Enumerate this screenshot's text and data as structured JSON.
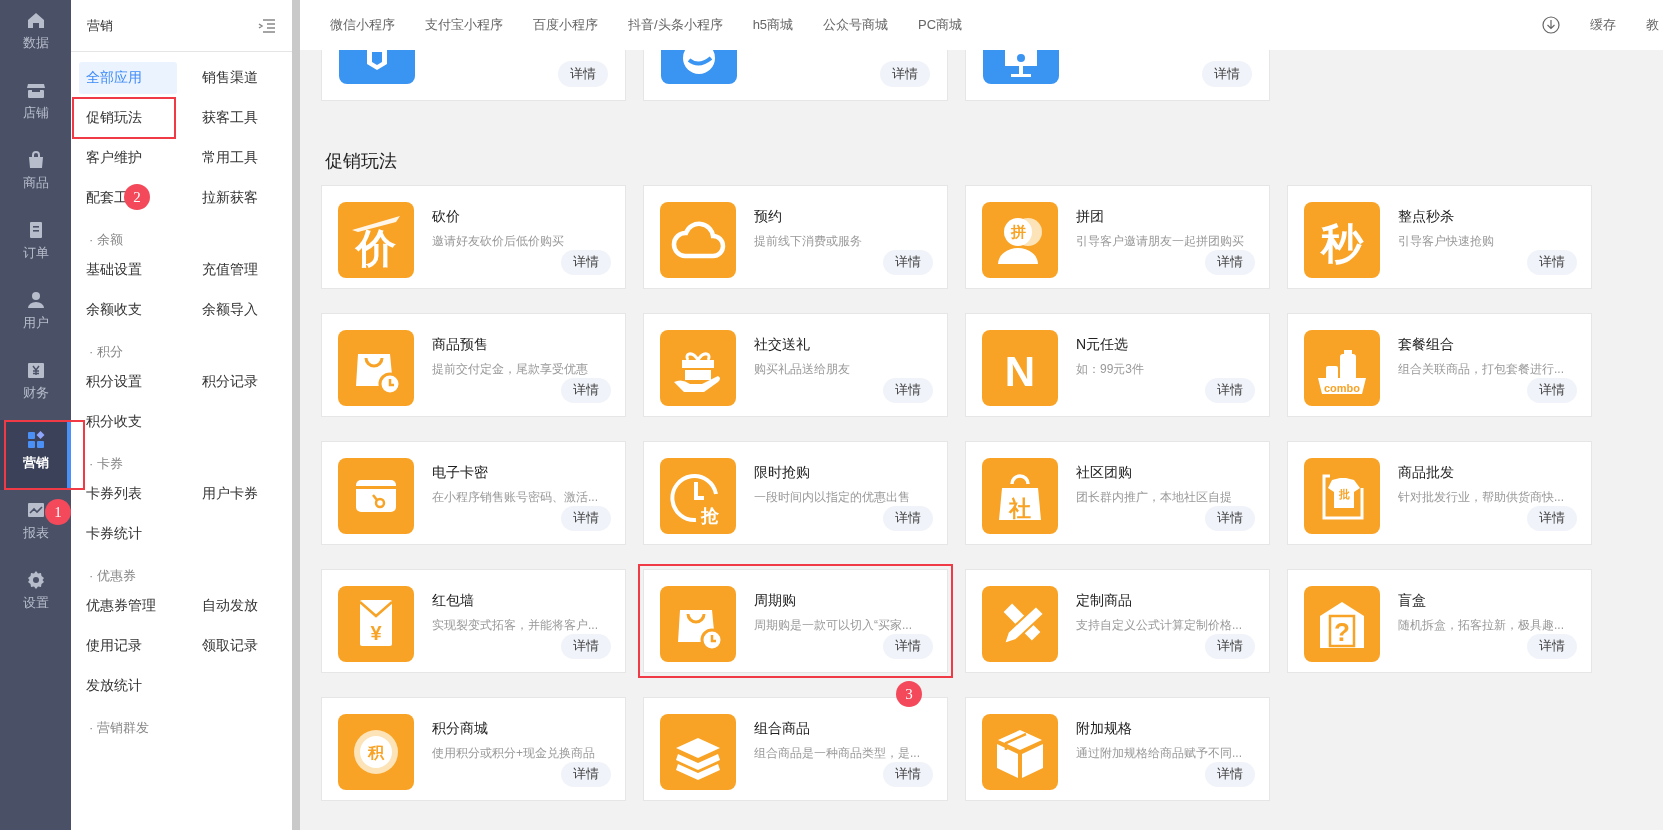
{
  "nav": {
    "items": [
      {
        "label": "数据",
        "kind": "home",
        "selected": false,
        "highlighted": false
      },
      {
        "label": "店铺",
        "kind": "store",
        "selected": false,
        "highlighted": false
      },
      {
        "label": "商品",
        "kind": "bag",
        "selected": false,
        "highlighted": false
      },
      {
        "label": "订单",
        "kind": "doc",
        "selected": false,
        "highlighted": false
      },
      {
        "label": "用户",
        "kind": "user",
        "selected": false,
        "highlighted": false
      },
      {
        "label": "财务",
        "kind": "money",
        "selected": false,
        "highlighted": false
      },
      {
        "label": "营销",
        "kind": "apps",
        "selected": true,
        "highlighted": true,
        "badge": "1"
      },
      {
        "label": "报表",
        "kind": "chart",
        "selected": false,
        "highlighted": false
      },
      {
        "label": "设置",
        "kind": "gear",
        "selected": false,
        "highlighted": false
      }
    ]
  },
  "sidebar": {
    "title": "营销",
    "groups": [
      {
        "items": [
          {
            "label": "全部应用",
            "selected": true,
            "highlighted": false
          },
          {
            "label": "销售渠道",
            "selected": false,
            "highlighted": false
          },
          {
            "label": "促销玩法",
            "selected": false,
            "highlighted": true,
            "badge": "2"
          },
          {
            "label": "获客工具",
            "selected": false,
            "highlighted": false
          },
          {
            "label": "客户维护",
            "selected": false,
            "highlighted": false
          },
          {
            "label": "常用工具",
            "selected": false,
            "highlighted": false
          },
          {
            "label": "配套工",
            "selected": false,
            "highlighted": false
          },
          {
            "label": "拉新获客",
            "selected": false,
            "highlighted": false
          }
        ]
      },
      {
        "title": "· 余额",
        "items": [
          {
            "label": "基础设置",
            "selected": false,
            "highlighted": false
          },
          {
            "label": "充值管理",
            "selected": false,
            "highlighted": false
          },
          {
            "label": "余额收支",
            "selected": false,
            "highlighted": false
          },
          {
            "label": "余额导入",
            "selected": false,
            "highlighted": false
          }
        ]
      },
      {
        "title": "· 积分",
        "items": [
          {
            "label": "积分设置",
            "selected": false,
            "highlighted": false
          },
          {
            "label": "积分记录",
            "selected": false,
            "highlighted": false
          },
          {
            "label": "积分收支",
            "selected": false,
            "highlighted": false
          }
        ]
      },
      {
        "title": "· 卡券",
        "items": [
          {
            "label": "卡券列表",
            "selected": false,
            "highlighted": false
          },
          {
            "label": "用户卡券",
            "selected": false,
            "highlighted": false
          },
          {
            "label": "卡券统计",
            "selected": false,
            "highlighted": false
          }
        ]
      },
      {
        "title": "· 优惠券",
        "items": [
          {
            "label": "优惠券管理",
            "selected": false,
            "highlighted": false
          },
          {
            "label": "自动发放",
            "selected": false,
            "highlighted": false
          },
          {
            "label": "使用记录",
            "selected": false,
            "highlighted": false
          },
          {
            "label": "领取记录",
            "selected": false,
            "highlighted": false
          },
          {
            "label": "发放统计",
            "selected": false,
            "highlighted": false
          }
        ]
      },
      {
        "title": "· 营销群发"
      }
    ]
  },
  "top_bar": {
    "tabs": [
      "微信小程序",
      "支付宝小程序",
      "百度小程序",
      "抖音/头条小程序",
      "h5商城",
      "公众号商城",
      "PC商城"
    ],
    "actions": [
      "缓存",
      "教"
    ]
  },
  "channel_cards": [
    {
      "icon": {
        "kind": "shield"
      },
      "button": "详情"
    },
    {
      "icon": {
        "kind": "chat"
      },
      "button": "详情"
    },
    {
      "icon": {
        "kind": "monitor"
      },
      "button": "详情"
    }
  ],
  "section_title": "促销玩法",
  "apps": [
    {
      "title": "砍价",
      "desc": "邀请好友砍价后低价购买",
      "icon": {
        "kind": "knife",
        "text": "价"
      },
      "button": "详情",
      "highlighted": false
    },
    {
      "title": "预约",
      "desc": "提前线下消费或服务",
      "icon": {
        "kind": "cloud"
      },
      "button": "详情",
      "highlighted": false
    },
    {
      "title": "拼团",
      "desc": "引导客户邀请朋友一起拼团购买",
      "icon": {
        "kind": "person",
        "text": "拼"
      },
      "button": "详情",
      "highlighted": false
    },
    {
      "title": "整点秒杀",
      "desc": "引导客户快速抢购",
      "icon": {
        "kind": "glyph",
        "text": "秒"
      },
      "button": "详情",
      "highlighted": false
    },
    {
      "title": "商品预售",
      "desc": "提前交付定金，尾款享受优惠",
      "icon": {
        "kind": "bagclock"
      },
      "button": "详情",
      "highlighted": false
    },
    {
      "title": "社交送礼",
      "desc": "购买礼品送给朋友",
      "icon": {
        "kind": "gift"
      },
      "button": "详情",
      "highlighted": false
    },
    {
      "title": "N元任选",
      "desc": "如：99元3件",
      "icon": {
        "kind": "glyph",
        "text": "N"
      },
      "button": "详情",
      "highlighted": false
    },
    {
      "title": "套餐组合",
      "desc": "组合关联商品，打包套餐进行...",
      "icon": {
        "kind": "combo",
        "text": "combo"
      },
      "button": "详情",
      "highlighted": false
    },
    {
      "title": "电子卡密",
      "desc": "在小程序销售账号密码、激活...",
      "icon": {
        "kind": "card"
      },
      "button": "详情",
      "highlighted": false
    },
    {
      "title": "限时抢购",
      "desc": "一段时间内以指定的优惠出售",
      "icon": {
        "kind": "clock",
        "text": "抢"
      },
      "button": "详情",
      "highlighted": false
    },
    {
      "title": "社区团购",
      "desc": "团长群内推广，本地社区自提",
      "icon": {
        "kind": "tote",
        "text": "社"
      },
      "button": "详情",
      "highlighted": false
    },
    {
      "title": "商品批发",
      "desc": "针对批发行业，帮助供货商快...",
      "icon": {
        "kind": "shirt",
        "text": "批"
      },
      "button": "详情",
      "highlighted": false
    },
    {
      "title": "红包墙",
      "desc": "实现裂变式拓客，并能将客户...",
      "icon": {
        "kind": "envelope",
        "text": "¥"
      },
      "button": "详情",
      "highlighted": false
    },
    {
      "title": "周期购",
      "desc": "周期购是一款可以切入“买家...",
      "icon": {
        "kind": "bagclock"
      },
      "button": "详情",
      "highlighted": true,
      "badge": "3"
    },
    {
      "title": "定制商品",
      "desc": "支持自定义公式计算定制价格...",
      "icon": {
        "kind": "ruler"
      },
      "button": "详情",
      "highlighted": false
    },
    {
      "title": "盲盒",
      "desc": "随机拆盒，拓客拉新，极具趣...",
      "icon": {
        "kind": "mystery",
        "text": "?"
      },
      "button": "详情",
      "highlighted": false
    },
    {
      "title": "积分商城",
      "desc": "使用积分或积分+现金兑换商品",
      "icon": {
        "kind": "coin",
        "text": "积"
      },
      "button": "详情",
      "highlighted": false
    },
    {
      "title": "组合商品",
      "desc": "组合商品是一种商品类型，是...",
      "icon": {
        "kind": "layers"
      },
      "button": "详情",
      "highlighted": false
    },
    {
      "title": "附加规格",
      "desc": "通过附加规格给商品赋予不同...",
      "icon": {
        "kind": "box"
      },
      "button": "详情",
      "highlighted": false
    }
  ]
}
